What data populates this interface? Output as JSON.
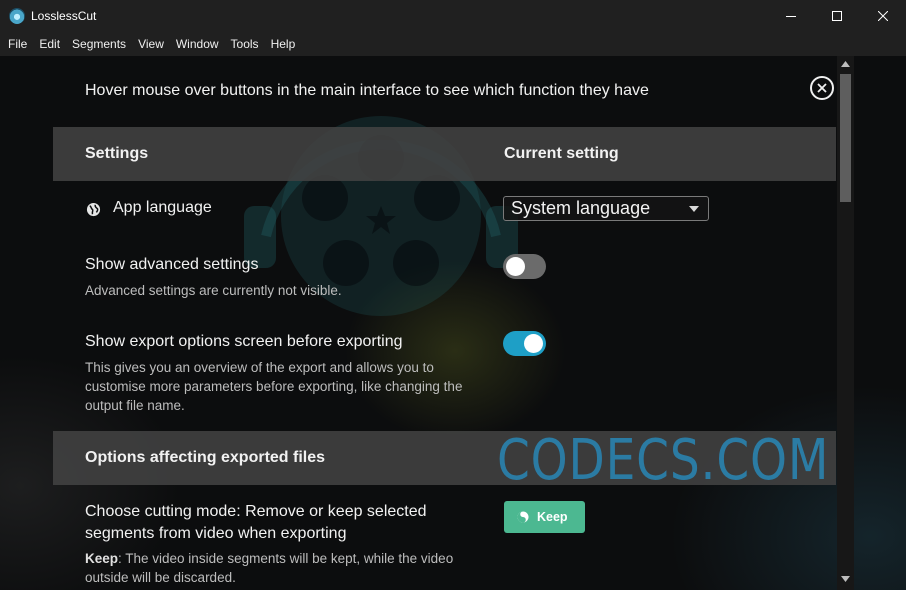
{
  "window": {
    "title": "LosslessCut"
  },
  "menu": [
    "File",
    "Edit",
    "Segments",
    "View",
    "Window",
    "Tools",
    "Help"
  ],
  "settings": {
    "hint": "Hover mouse over buttons in the main interface to see which function they have",
    "header": {
      "col1": "Settings",
      "col2": "Current setting"
    },
    "app_language": {
      "label": "App language",
      "value": "System language"
    },
    "advanced": {
      "label": "Show advanced settings",
      "desc": "Advanced settings are currently not visible.",
      "enabled": false
    },
    "export_screen": {
      "label": "Show export options screen before exporting",
      "desc": "This gives you an overview of the export and allows you to customise more parameters before exporting, like changing the output file name.",
      "enabled": true
    },
    "section2": {
      "title": "Options affecting exported files"
    },
    "cutting_mode": {
      "label": "Choose cutting mode: Remove or keep selected segments from video when exporting",
      "desc_bold": "Keep",
      "desc_rest": ": The video inside segments will be kept, while the video outside will be discarded.",
      "button": "Keep"
    }
  },
  "watermark": "CODECS.COM",
  "colors": {
    "accent_toggle": "#1e9fc6",
    "keep_button": "#4cb891",
    "watermark": "#288cbe"
  }
}
